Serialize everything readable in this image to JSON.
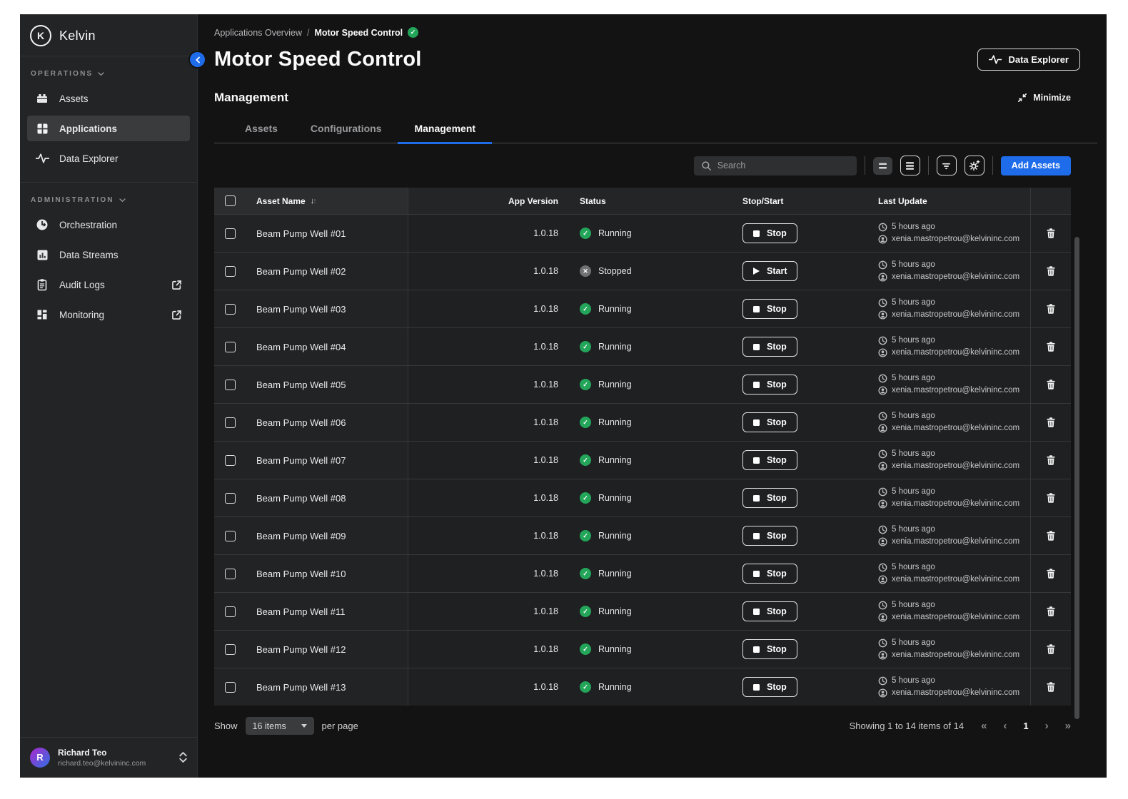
{
  "colors": {
    "accent_blue": "#1f6ceb",
    "running_green": "#23a55a",
    "stopped_gray": "#707174"
  },
  "icons": {
    "check": "✓",
    "cross": "✕",
    "sort_down": "↓",
    "sort_up": "↑"
  },
  "sidebar": {
    "logo_initial": "K",
    "logo_text": "Kelvin",
    "sections": [
      {
        "label": "OPERATIONS",
        "items": [
          {
            "label": "Assets"
          },
          {
            "label": "Applications"
          },
          {
            "label": "Data Explorer"
          }
        ]
      },
      {
        "label": "ADMINISTRATION",
        "items": [
          {
            "label": "Orchestration"
          },
          {
            "label": "Data Streams"
          },
          {
            "label": "Audit Logs"
          },
          {
            "label": "Monitoring"
          }
        ]
      }
    ],
    "user": {
      "initial": "R",
      "name": "Richard Teo",
      "email": "richard.teo@kelvininc.com"
    }
  },
  "header": {
    "breadcrumb": {
      "parent": "Applications Overview",
      "separator": "/",
      "current": "Motor Speed Control",
      "badge": "✓"
    },
    "title": "Motor Speed Control",
    "data_explorer_label": "Data Explorer"
  },
  "panel": {
    "heading": "Management",
    "minimize_label": "Minimize",
    "tabs": [
      {
        "label": "Assets"
      },
      {
        "label": "Configurations"
      },
      {
        "label": "Management"
      }
    ]
  },
  "toolbar": {
    "search_placeholder": "Search",
    "add_assets_label": "Add Assets"
  },
  "table": {
    "columns": {
      "asset_name": "Asset Name",
      "app_version": "App Version",
      "status": "Status",
      "stop_start": "Stop/Start",
      "last_update": "Last Update"
    },
    "rows": [
      {
        "name": "Beam Pump Well #01",
        "version": "1.0.18",
        "status": "Running",
        "status_type": "running",
        "status_glyph": "✓",
        "action": "Stop",
        "action_type": "stop",
        "updated": "5 hours ago",
        "updated_by": "xenia.mastropetrou@kelvininc.com"
      },
      {
        "name": "Beam Pump Well #02",
        "version": "1.0.18",
        "status": "Stopped",
        "status_type": "stopped",
        "status_glyph": "✕",
        "action": "Start",
        "action_type": "start",
        "updated": "5 hours ago",
        "updated_by": "xenia.mastropetrou@kelvininc.com"
      },
      {
        "name": "Beam Pump Well #03",
        "version": "1.0.18",
        "status": "Running",
        "status_type": "running",
        "status_glyph": "✓",
        "action": "Stop",
        "action_type": "stop",
        "updated": "5 hours ago",
        "updated_by": "xenia.mastropetrou@kelvininc.com"
      },
      {
        "name": "Beam Pump Well #04",
        "version": "1.0.18",
        "status": "Running",
        "status_type": "running",
        "status_glyph": "✓",
        "action": "Stop",
        "action_type": "stop",
        "updated": "5 hours ago",
        "updated_by": "xenia.mastropetrou@kelvininc.com"
      },
      {
        "name": "Beam Pump Well #05",
        "version": "1.0.18",
        "status": "Running",
        "status_type": "running",
        "status_glyph": "✓",
        "action": "Stop",
        "action_type": "stop",
        "updated": "5 hours ago",
        "updated_by": "xenia.mastropetrou@kelvininc.com"
      },
      {
        "name": "Beam Pump Well #06",
        "version": "1.0.18",
        "status": "Running",
        "status_type": "running",
        "status_glyph": "✓",
        "action": "Stop",
        "action_type": "stop",
        "updated": "5 hours ago",
        "updated_by": "xenia.mastropetrou@kelvininc.com"
      },
      {
        "name": "Beam Pump Well #07",
        "version": "1.0.18",
        "status": "Running",
        "status_type": "running",
        "status_glyph": "✓",
        "action": "Stop",
        "action_type": "stop",
        "updated": "5 hours ago",
        "updated_by": "xenia.mastropetrou@kelvininc.com"
      },
      {
        "name": "Beam Pump Well #08",
        "version": "1.0.18",
        "status": "Running",
        "status_type": "running",
        "status_glyph": "✓",
        "action": "Stop",
        "action_type": "stop",
        "updated": "5 hours ago",
        "updated_by": "xenia.mastropetrou@kelvininc.com"
      },
      {
        "name": "Beam Pump Well #09",
        "version": "1.0.18",
        "status": "Running",
        "status_type": "running",
        "status_glyph": "✓",
        "action": "Stop",
        "action_type": "stop",
        "updated": "5 hours ago",
        "updated_by": "xenia.mastropetrou@kelvininc.com"
      },
      {
        "name": "Beam Pump Well #10",
        "version": "1.0.18",
        "status": "Running",
        "status_type": "running",
        "status_glyph": "✓",
        "action": "Stop",
        "action_type": "stop",
        "updated": "5 hours ago",
        "updated_by": "xenia.mastropetrou@kelvininc.com"
      },
      {
        "name": "Beam Pump Well #11",
        "version": "1.0.18",
        "status": "Running",
        "status_type": "running",
        "status_glyph": "✓",
        "action": "Stop",
        "action_type": "stop",
        "updated": "5 hours ago",
        "updated_by": "xenia.mastropetrou@kelvininc.com"
      },
      {
        "name": "Beam Pump Well #12",
        "version": "1.0.18",
        "status": "Running",
        "status_type": "running",
        "status_glyph": "✓",
        "action": "Stop",
        "action_type": "stop",
        "updated": "5 hours ago",
        "updated_by": "xenia.mastropetrou@kelvininc.com"
      },
      {
        "name": "Beam Pump Well #13",
        "version": "1.0.18",
        "status": "Running",
        "status_type": "running",
        "status_glyph": "✓",
        "action": "Stop",
        "action_type": "stop",
        "updated": "5 hours ago",
        "updated_by": "xenia.mastropetrou@kelvininc.com"
      }
    ]
  },
  "footer": {
    "show_label": "Show",
    "page_size_value": "16 items",
    "per_page_label": "per page",
    "showing_text": "Showing 1 to 14 items of 14",
    "page_number": "1",
    "pager": {
      "first": "«",
      "prev": "‹",
      "next": "›",
      "last": "»"
    }
  }
}
